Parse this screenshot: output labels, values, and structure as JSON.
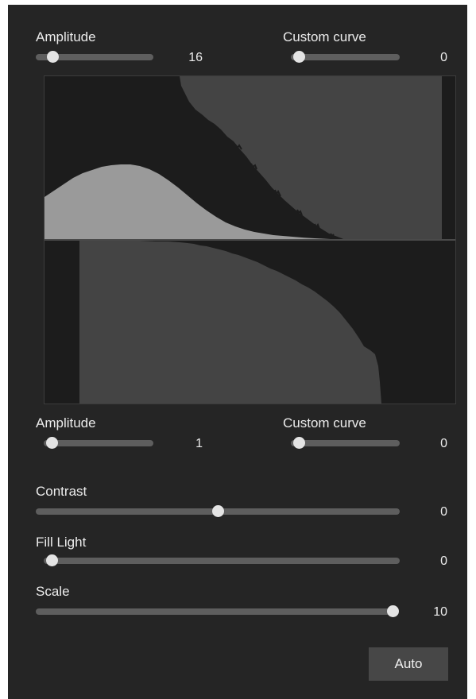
{
  "top_controls": {
    "amplitude_label": "Amplitude",
    "amplitude_value": "16",
    "amplitude_fraction": 0.14,
    "custom_curve_label": "Custom curve",
    "custom_curve_value": "0",
    "custom_curve_fraction": 0.0
  },
  "bottom_controls": {
    "amplitude_label": "Amplitude",
    "amplitude_value": "1",
    "amplitude_fraction": 0.0,
    "custom_curve_label": "Custom curve",
    "custom_curve_value": "0",
    "custom_curve_fraction": 0.0
  },
  "sliders": {
    "contrast": {
      "label": "Contrast",
      "value": "0",
      "fraction": 0.5
    },
    "fill_light": {
      "label": "Fill Light",
      "value": "0",
      "fraction": 0.0
    },
    "scale": {
      "label": "Scale",
      "value": "10",
      "fraction": 1.0
    }
  },
  "auto_button": {
    "label": "Auto"
  },
  "colors": {
    "panel": "#252525",
    "histogram_bg": "#1c1c1c",
    "histogram_dark_fill": "#444444",
    "bell_curve_fill": "#9a9a9a",
    "slider_track": "#5e5e5e",
    "slider_thumb": "#e4e4e4"
  }
}
